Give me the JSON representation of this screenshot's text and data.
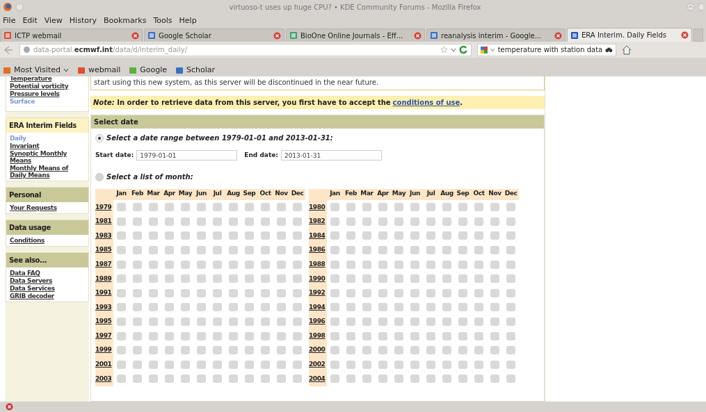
{
  "window": {
    "title": "virtuoso-t uses up huge CPU? • KDE Community Forums - Mozilla Firefox"
  },
  "menu": [
    "File",
    "Edit",
    "View",
    "History",
    "Bookmarks",
    "Tools",
    "Help"
  ],
  "tabs": [
    {
      "label": "ICTP webmail",
      "selected": false
    },
    {
      "label": "Google Scholar",
      "selected": false
    },
    {
      "label": "BioOne Online Journals - Eff...",
      "selected": false
    },
    {
      "label": "reanalysis interim - Google...",
      "selected": false
    },
    {
      "label": "ERA Interim. Daily Fields",
      "selected": true
    }
  ],
  "address_bar": {
    "url": "data-portal.**ecmwf.int**/data/d/interim_daily/"
  },
  "search": {
    "value": "temperature with station data"
  },
  "bookmarks": [
    "Most Visited",
    "webmail",
    "Google",
    "Scholar"
  ],
  "sidebar": [
    {
      "items": [
        {
          "label": "Temperature",
          "current": false
        },
        {
          "label": "Potential vorticity",
          "current": false
        },
        {
          "label": "Pressure levels",
          "current": false
        },
        {
          "label": "Surface",
          "current": true
        }
      ]
    },
    {
      "heading": "ERA Interim Fields",
      "highlighted": true,
      "items": [
        {
          "label": "Daily",
          "current": true
        },
        {
          "label": "Invariant",
          "current": false
        },
        {
          "label": "Synoptic Monthly Means",
          "current": false
        },
        {
          "label": "Monthly Means of Daily Means",
          "current": false
        }
      ]
    },
    {
      "heading": "Personal",
      "highlighted": false,
      "items": [
        {
          "label": "Your Requests",
          "current": false
        }
      ]
    },
    {
      "heading": "Data usage",
      "highlighted": false,
      "items": [
        {
          "label": "Conditions",
          "current": false
        }
      ]
    },
    {
      "heading": "See also...",
      "highlighted": false,
      "items": [
        {
          "label": "Data FAQ",
          "current": false
        },
        {
          "label": "Data Servers",
          "current": false
        },
        {
          "label": "Data Services",
          "current": false
        },
        {
          "label": "GRIB decoder",
          "current": false
        }
      ]
    }
  ],
  "notice": "start using this new system, as this server will be discontinued in the near future.",
  "note": {
    "text": "*Note:* In order to retrieve data from this server, you first have to accept the",
    "link": "conditions of use",
    "after": "."
  },
  "select_date": {
    "heading": "Select date",
    "options": [
      {
        "label": "Select a date range between 1979-01-01 and 2013-01-31:",
        "selected": true
      },
      {
        "label": "Select a list of month:",
        "selected": false
      }
    ],
    "start_label": "Start date:",
    "start_value": "1979-01-01",
    "end_label": "End date:",
    "end_value": "2013-01-31",
    "blocks": [
      {
        "months": [
          "Jan",
          "Feb",
          "Mar",
          "Apr",
          "May",
          "Jun",
          "Jul",
          "Aug",
          "Sep",
          "Oct",
          "Nov",
          "Dec"
        ],
        "rows": [
          {
            "year": "1979",
            "checked": [
              false,
              false,
              false,
              false,
              false,
              false,
              false,
              false,
              false,
              false,
              false,
              false
            ]
          },
          {
            "year": "1981",
            "checked": [
              false,
              false,
              false,
              false,
              false,
              false,
              false,
              false,
              false,
              false,
              false,
              false
            ]
          },
          {
            "year": "1983",
            "checked": [
              false,
              false,
              false,
              false,
              false,
              false,
              false,
              false,
              false,
              false,
              false,
              false
            ]
          },
          {
            "year": "1985",
            "checked": [
              false,
              false,
              false,
              false,
              false,
              false,
              false,
              false,
              false,
              false,
              false,
              false
            ]
          },
          {
            "year": "1987",
            "checked": [
              false,
              false,
              false,
              false,
              false,
              false,
              false,
              false,
              false,
              false,
              false,
              false
            ]
          },
          {
            "year": "1989",
            "checked": [
              false,
              false,
              false,
              false,
              false,
              false,
              false,
              false,
              false,
              false,
              false,
              false
            ]
          },
          {
            "year": "1991",
            "checked": [
              false,
              false,
              false,
              false,
              false,
              false,
              false,
              false,
              false,
              false,
              false,
              false
            ]
          },
          {
            "year": "1993",
            "checked": [
              false,
              false,
              false,
              false,
              false,
              false,
              false,
              false,
              false,
              false,
              false,
              false
            ]
          },
          {
            "year": "1995",
            "checked": [
              false,
              false,
              false,
              false,
              false,
              false,
              false,
              false,
              false,
              false,
              false,
              false
            ]
          },
          {
            "year": "1997",
            "checked": [
              false,
              false,
              false,
              false,
              false,
              false,
              false,
              false,
              false,
              false,
              false,
              false
            ]
          },
          {
            "year": "1999",
            "checked": [
              false,
              false,
              false,
              false,
              false,
              false,
              false,
              false,
              false,
              false,
              false,
              false
            ]
          },
          {
            "year": "2001",
            "checked": [
              false,
              false,
              false,
              false,
              false,
              false,
              false,
              false,
              false,
              false,
              false,
              false
            ]
          },
          {
            "year": "2003",
            "checked": [
              false,
              false,
              false,
              false,
              false,
              false,
              false,
              false,
              false,
              false,
              false,
              false
            ]
          }
        ]
      },
      {
        "months": [
          "Jan",
          "Feb",
          "Mar",
          "Apr",
          "May",
          "Jun",
          "Jul",
          "Aug",
          "Sep",
          "Oct",
          "Nov",
          "Dec"
        ],
        "rows": [
          {
            "year": "1980",
            "checked": [
              false,
              false,
              false,
              false,
              false,
              false,
              false,
              false,
              false,
              false,
              false,
              false
            ]
          },
          {
            "year": "1982",
            "checked": [
              false,
              false,
              false,
              false,
              false,
              false,
              false,
              false,
              false,
              false,
              false,
              false
            ]
          },
          {
            "year": "1984",
            "checked": [
              false,
              false,
              false,
              false,
              false,
              false,
              false,
              false,
              false,
              false,
              false,
              false
            ]
          },
          {
            "year": "1986",
            "checked": [
              false,
              false,
              false,
              false,
              false,
              false,
              false,
              false,
              false,
              false,
              false,
              false
            ]
          },
          {
            "year": "1988",
            "checked": [
              false,
              false,
              false,
              false,
              false,
              false,
              false,
              false,
              false,
              false,
              false,
              false
            ]
          },
          {
            "year": "1990",
            "checked": [
              false,
              false,
              false,
              false,
              false,
              false,
              false,
              false,
              false,
              false,
              false,
              false
            ]
          },
          {
            "year": "1992",
            "checked": [
              false,
              false,
              false,
              false,
              false,
              false,
              false,
              false,
              false,
              false,
              false,
              false
            ]
          },
          {
            "year": "1994",
            "checked": [
              false,
              false,
              false,
              false,
              false,
              false,
              false,
              false,
              false,
              false,
              false,
              false
            ]
          },
          {
            "year": "1996",
            "checked": [
              false,
              false,
              false,
              false,
              false,
              false,
              false,
              false,
              false,
              false,
              false,
              false
            ]
          },
          {
            "year": "1998",
            "checked": [
              false,
              false,
              false,
              false,
              false,
              false,
              false,
              false,
              false,
              false,
              false,
              false
            ]
          },
          {
            "year": "2000",
            "checked": [
              false,
              false,
              false,
              false,
              false,
              false,
              false,
              false,
              false,
              false,
              false,
              false
            ]
          },
          {
            "year": "2002",
            "checked": [
              false,
              false,
              false,
              false,
              false,
              false,
              false,
              false,
              false,
              false,
              false,
              false
            ]
          },
          {
            "year": "2004",
            "checked": [
              false,
              false,
              false,
              false,
              false,
              false,
              false,
              false,
              false,
              false,
              false,
              false
            ]
          }
        ]
      }
    ]
  }
}
